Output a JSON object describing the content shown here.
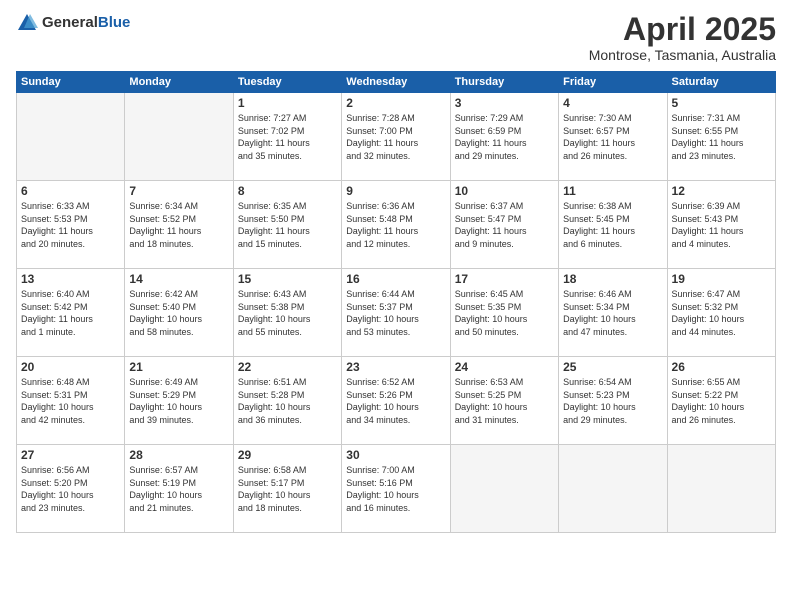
{
  "header": {
    "logo_general": "General",
    "logo_blue": "Blue",
    "month_title": "April 2025",
    "location": "Montrose, Tasmania, Australia"
  },
  "weekdays": [
    "Sunday",
    "Monday",
    "Tuesday",
    "Wednesday",
    "Thursday",
    "Friday",
    "Saturday"
  ],
  "weeks": [
    [
      {
        "day": "",
        "info": ""
      },
      {
        "day": "",
        "info": ""
      },
      {
        "day": "1",
        "info": "Sunrise: 7:27 AM\nSunset: 7:02 PM\nDaylight: 11 hours\nand 35 minutes."
      },
      {
        "day": "2",
        "info": "Sunrise: 7:28 AM\nSunset: 7:00 PM\nDaylight: 11 hours\nand 32 minutes."
      },
      {
        "day": "3",
        "info": "Sunrise: 7:29 AM\nSunset: 6:59 PM\nDaylight: 11 hours\nand 29 minutes."
      },
      {
        "day": "4",
        "info": "Sunrise: 7:30 AM\nSunset: 6:57 PM\nDaylight: 11 hours\nand 26 minutes."
      },
      {
        "day": "5",
        "info": "Sunrise: 7:31 AM\nSunset: 6:55 PM\nDaylight: 11 hours\nand 23 minutes."
      }
    ],
    [
      {
        "day": "6",
        "info": "Sunrise: 6:33 AM\nSunset: 5:53 PM\nDaylight: 11 hours\nand 20 minutes."
      },
      {
        "day": "7",
        "info": "Sunrise: 6:34 AM\nSunset: 5:52 PM\nDaylight: 11 hours\nand 18 minutes."
      },
      {
        "day": "8",
        "info": "Sunrise: 6:35 AM\nSunset: 5:50 PM\nDaylight: 11 hours\nand 15 minutes."
      },
      {
        "day": "9",
        "info": "Sunrise: 6:36 AM\nSunset: 5:48 PM\nDaylight: 11 hours\nand 12 minutes."
      },
      {
        "day": "10",
        "info": "Sunrise: 6:37 AM\nSunset: 5:47 PM\nDaylight: 11 hours\nand 9 minutes."
      },
      {
        "day": "11",
        "info": "Sunrise: 6:38 AM\nSunset: 5:45 PM\nDaylight: 11 hours\nand 6 minutes."
      },
      {
        "day": "12",
        "info": "Sunrise: 6:39 AM\nSunset: 5:43 PM\nDaylight: 11 hours\nand 4 minutes."
      }
    ],
    [
      {
        "day": "13",
        "info": "Sunrise: 6:40 AM\nSunset: 5:42 PM\nDaylight: 11 hours\nand 1 minute."
      },
      {
        "day": "14",
        "info": "Sunrise: 6:42 AM\nSunset: 5:40 PM\nDaylight: 10 hours\nand 58 minutes."
      },
      {
        "day": "15",
        "info": "Sunrise: 6:43 AM\nSunset: 5:38 PM\nDaylight: 10 hours\nand 55 minutes."
      },
      {
        "day": "16",
        "info": "Sunrise: 6:44 AM\nSunset: 5:37 PM\nDaylight: 10 hours\nand 53 minutes."
      },
      {
        "day": "17",
        "info": "Sunrise: 6:45 AM\nSunset: 5:35 PM\nDaylight: 10 hours\nand 50 minutes."
      },
      {
        "day": "18",
        "info": "Sunrise: 6:46 AM\nSunset: 5:34 PM\nDaylight: 10 hours\nand 47 minutes."
      },
      {
        "day": "19",
        "info": "Sunrise: 6:47 AM\nSunset: 5:32 PM\nDaylight: 10 hours\nand 44 minutes."
      }
    ],
    [
      {
        "day": "20",
        "info": "Sunrise: 6:48 AM\nSunset: 5:31 PM\nDaylight: 10 hours\nand 42 minutes."
      },
      {
        "day": "21",
        "info": "Sunrise: 6:49 AM\nSunset: 5:29 PM\nDaylight: 10 hours\nand 39 minutes."
      },
      {
        "day": "22",
        "info": "Sunrise: 6:51 AM\nSunset: 5:28 PM\nDaylight: 10 hours\nand 36 minutes."
      },
      {
        "day": "23",
        "info": "Sunrise: 6:52 AM\nSunset: 5:26 PM\nDaylight: 10 hours\nand 34 minutes."
      },
      {
        "day": "24",
        "info": "Sunrise: 6:53 AM\nSunset: 5:25 PM\nDaylight: 10 hours\nand 31 minutes."
      },
      {
        "day": "25",
        "info": "Sunrise: 6:54 AM\nSunset: 5:23 PM\nDaylight: 10 hours\nand 29 minutes."
      },
      {
        "day": "26",
        "info": "Sunrise: 6:55 AM\nSunset: 5:22 PM\nDaylight: 10 hours\nand 26 minutes."
      }
    ],
    [
      {
        "day": "27",
        "info": "Sunrise: 6:56 AM\nSunset: 5:20 PM\nDaylight: 10 hours\nand 23 minutes."
      },
      {
        "day": "28",
        "info": "Sunrise: 6:57 AM\nSunset: 5:19 PM\nDaylight: 10 hours\nand 21 minutes."
      },
      {
        "day": "29",
        "info": "Sunrise: 6:58 AM\nSunset: 5:17 PM\nDaylight: 10 hours\nand 18 minutes."
      },
      {
        "day": "30",
        "info": "Sunrise: 7:00 AM\nSunset: 5:16 PM\nDaylight: 10 hours\nand 16 minutes."
      },
      {
        "day": "",
        "info": ""
      },
      {
        "day": "",
        "info": ""
      },
      {
        "day": "",
        "info": ""
      }
    ]
  ]
}
